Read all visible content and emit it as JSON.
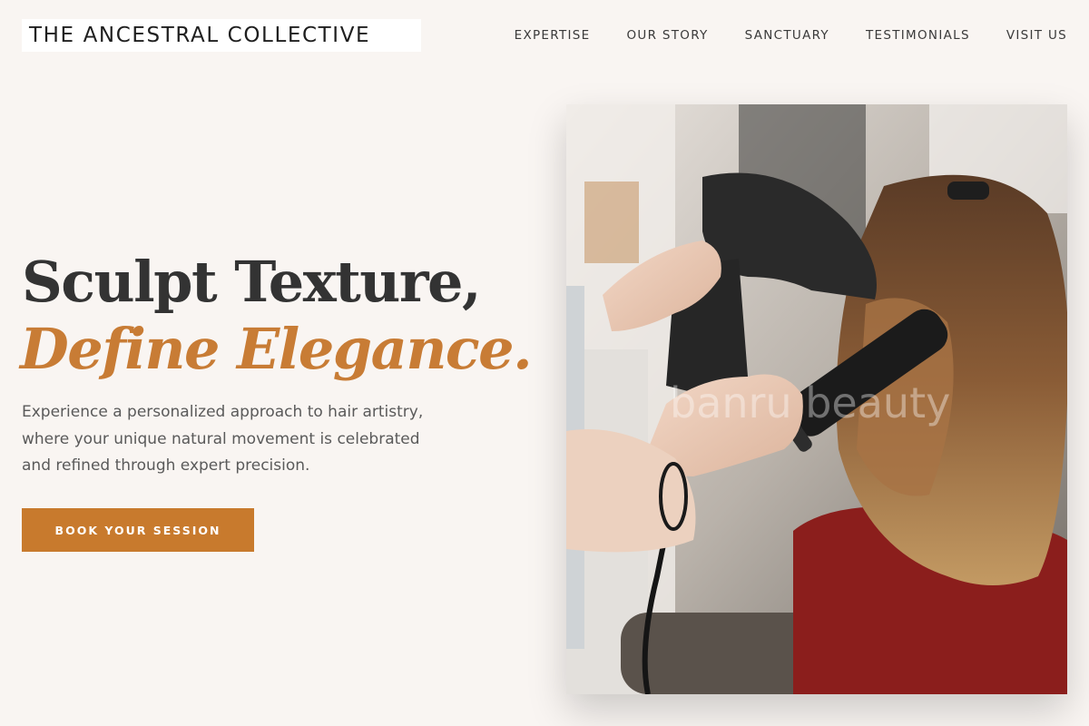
{
  "header": {
    "logo": "THE ANCESTRAL COLLECTIVE",
    "nav": [
      "EXPERTISE",
      "OUR STORY",
      "SANCTUARY",
      "TESTIMONIALS",
      "VISIT US"
    ]
  },
  "hero": {
    "headline_line1": "Sculpt Texture,",
    "headline_line2": "Define Elegance.",
    "description": "Experience a personalized approach to hair artistry, where your unique natural movement is celebrated and refined through expert precision.",
    "cta_label": "BOOK YOUR SESSION",
    "image_watermark": "banru beauty"
  },
  "colors": {
    "background": "#f9f5f2",
    "accent": "#c87a2d",
    "text_dark": "#333333",
    "text_muted": "#5a5a5a"
  }
}
